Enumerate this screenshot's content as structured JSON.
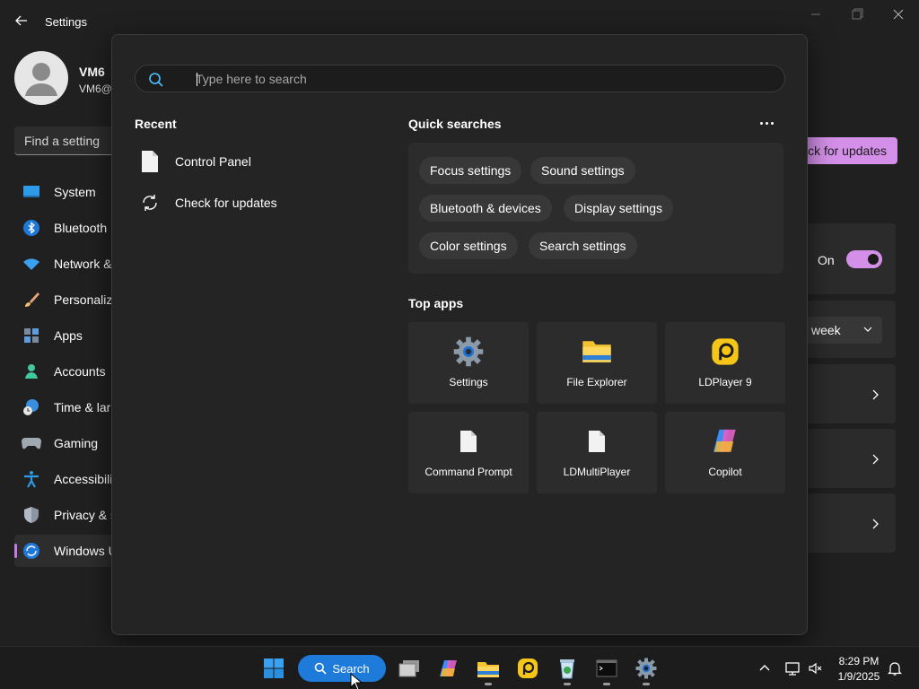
{
  "settings": {
    "title": "Settings",
    "profile": {
      "name": "VM6",
      "email": "VM6@"
    },
    "find_placeholder": "Find a setting",
    "nav": [
      {
        "label": "System",
        "icon": "monitor-icon"
      },
      {
        "label": "Bluetooth",
        "icon": "bluetooth-icon"
      },
      {
        "label": "Network &",
        "icon": "wifi-icon"
      },
      {
        "label": "Personaliz",
        "icon": "brush-icon"
      },
      {
        "label": "Apps",
        "icon": "apps-icon"
      },
      {
        "label": "Accounts",
        "icon": "person-icon"
      },
      {
        "label": "Time & lar",
        "icon": "globe-clock-icon"
      },
      {
        "label": "Gaming",
        "icon": "gamepad-icon"
      },
      {
        "label": "Accessibilit",
        "icon": "accessibility-icon"
      },
      {
        "label": "Privacy & s",
        "icon": "shield-icon"
      },
      {
        "label": "Windows U",
        "icon": "windows-update-icon",
        "active": true
      }
    ],
    "check_updates_label": "ck for updates",
    "toggle_label": "On",
    "toggle_on": true,
    "week_value": "week",
    "accent_color": "#d490e9"
  },
  "search": {
    "placeholder": "Type here to search",
    "recent_title": "Recent",
    "recent": [
      {
        "label": "Control Panel",
        "icon": "document-icon"
      },
      {
        "label": "Check for updates",
        "icon": "refresh-icon"
      }
    ],
    "quick_title": "Quick searches",
    "quick": [
      "Focus settings",
      "Sound settings",
      "Bluetooth & devices",
      "Display settings",
      "Color settings",
      "Search settings"
    ],
    "top_apps_title": "Top apps",
    "apps": [
      {
        "label": "Settings",
        "icon": "gear-icon"
      },
      {
        "label": "File Explorer",
        "icon": "folder-icon"
      },
      {
        "label": "LDPlayer 9",
        "icon": "ldplayer-icon"
      },
      {
        "label": "Command Prompt",
        "icon": "document-icon"
      },
      {
        "label": "LDMultiPlayer",
        "icon": "document-icon"
      },
      {
        "label": "Copilot",
        "icon": "copilot-icon"
      }
    ]
  },
  "taskbar": {
    "search_label": "Search",
    "time": "8:29 PM",
    "date": "1/9/2025",
    "search_color": "#1e7bd9"
  }
}
